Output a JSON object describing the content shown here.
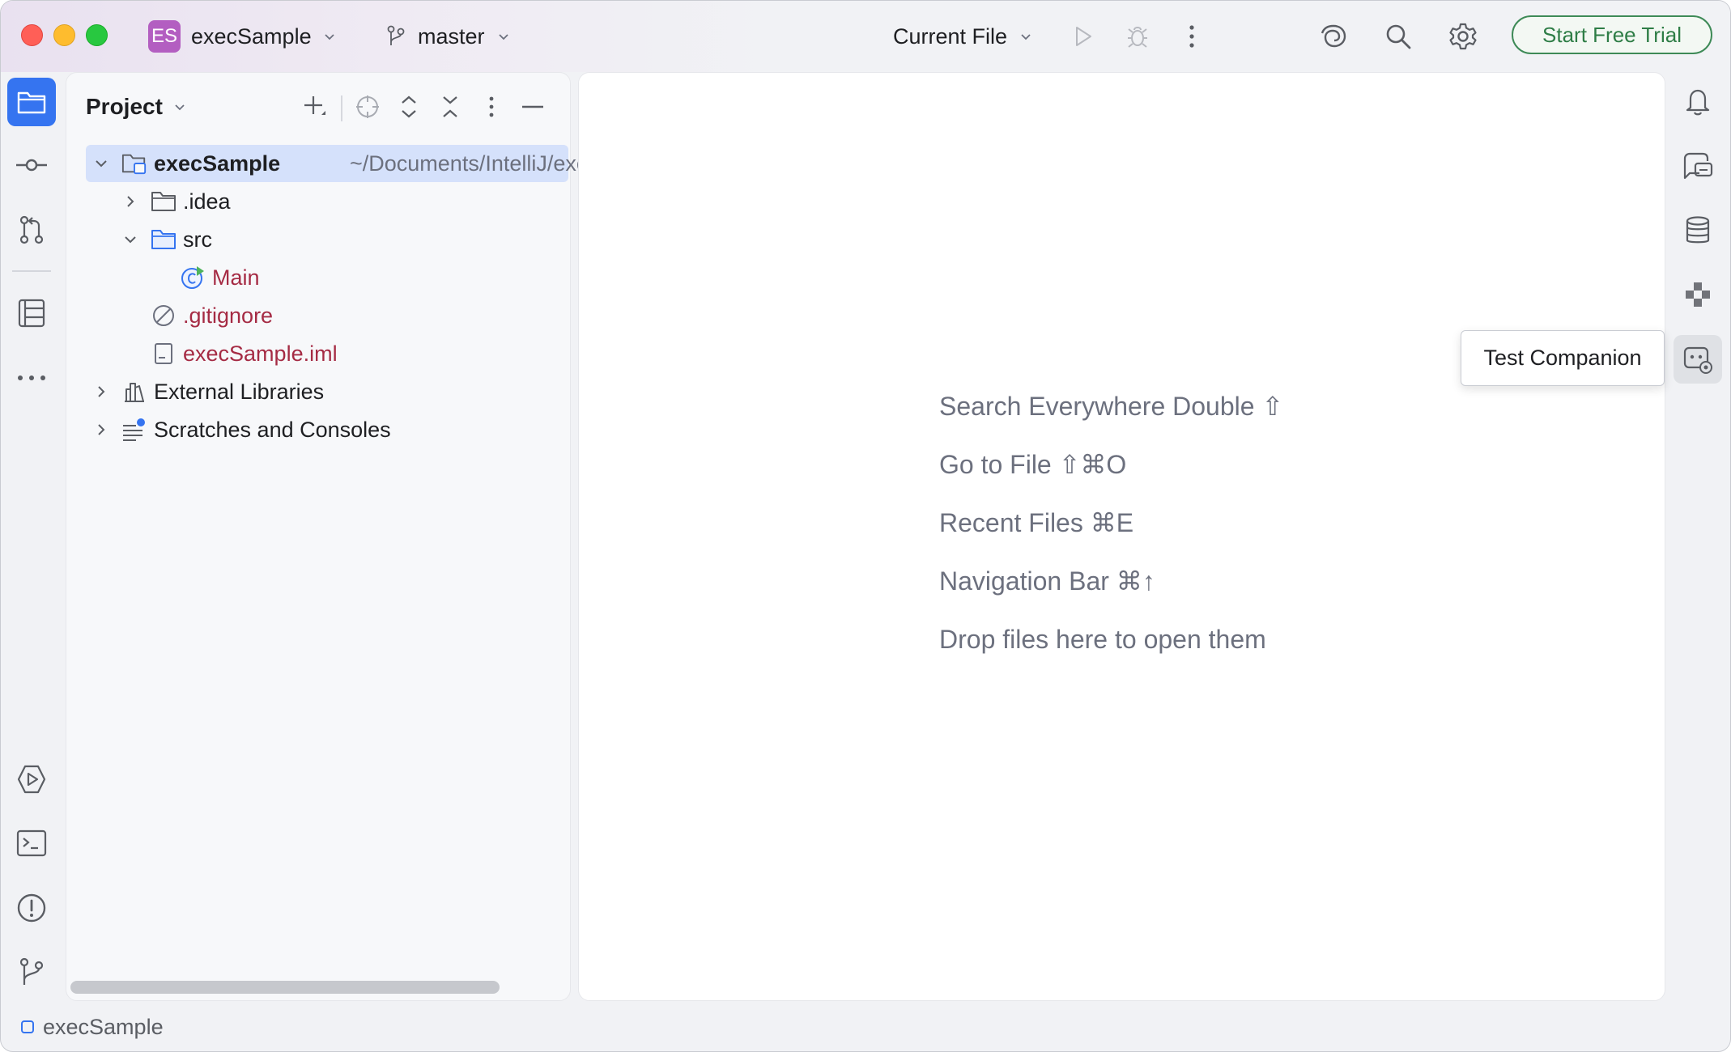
{
  "titlebar": {
    "project_badge": "ES",
    "project_name": "execSample",
    "branch": "master",
    "run_config": "Current File",
    "trial_button": "Start Free Trial"
  },
  "project_panel": {
    "title": "Project",
    "tree": {
      "root_name": "execSample",
      "root_path": "~/Documents/IntelliJ/execSa",
      "idea": ".idea",
      "src": "src",
      "main": "Main",
      "gitignore": ".gitignore",
      "iml": "execSample.iml",
      "external_libraries": "External Libraries",
      "scratches": "Scratches and Consoles"
    }
  },
  "editor": {
    "hints": [
      "Search Everywhere Double ⇧",
      "Go to File ⇧⌘O",
      "Recent Files ⌘E",
      "Navigation Bar ⌘↑",
      "Drop files here to open them"
    ]
  },
  "tooltip": {
    "text": "Test Companion"
  },
  "statusbar": {
    "project": "execSample"
  },
  "colors": {
    "accent": "#3574f0",
    "trial_green": "#2e7d46",
    "badge_purple": "#b35ec1",
    "modified_red": "#a52b44"
  }
}
